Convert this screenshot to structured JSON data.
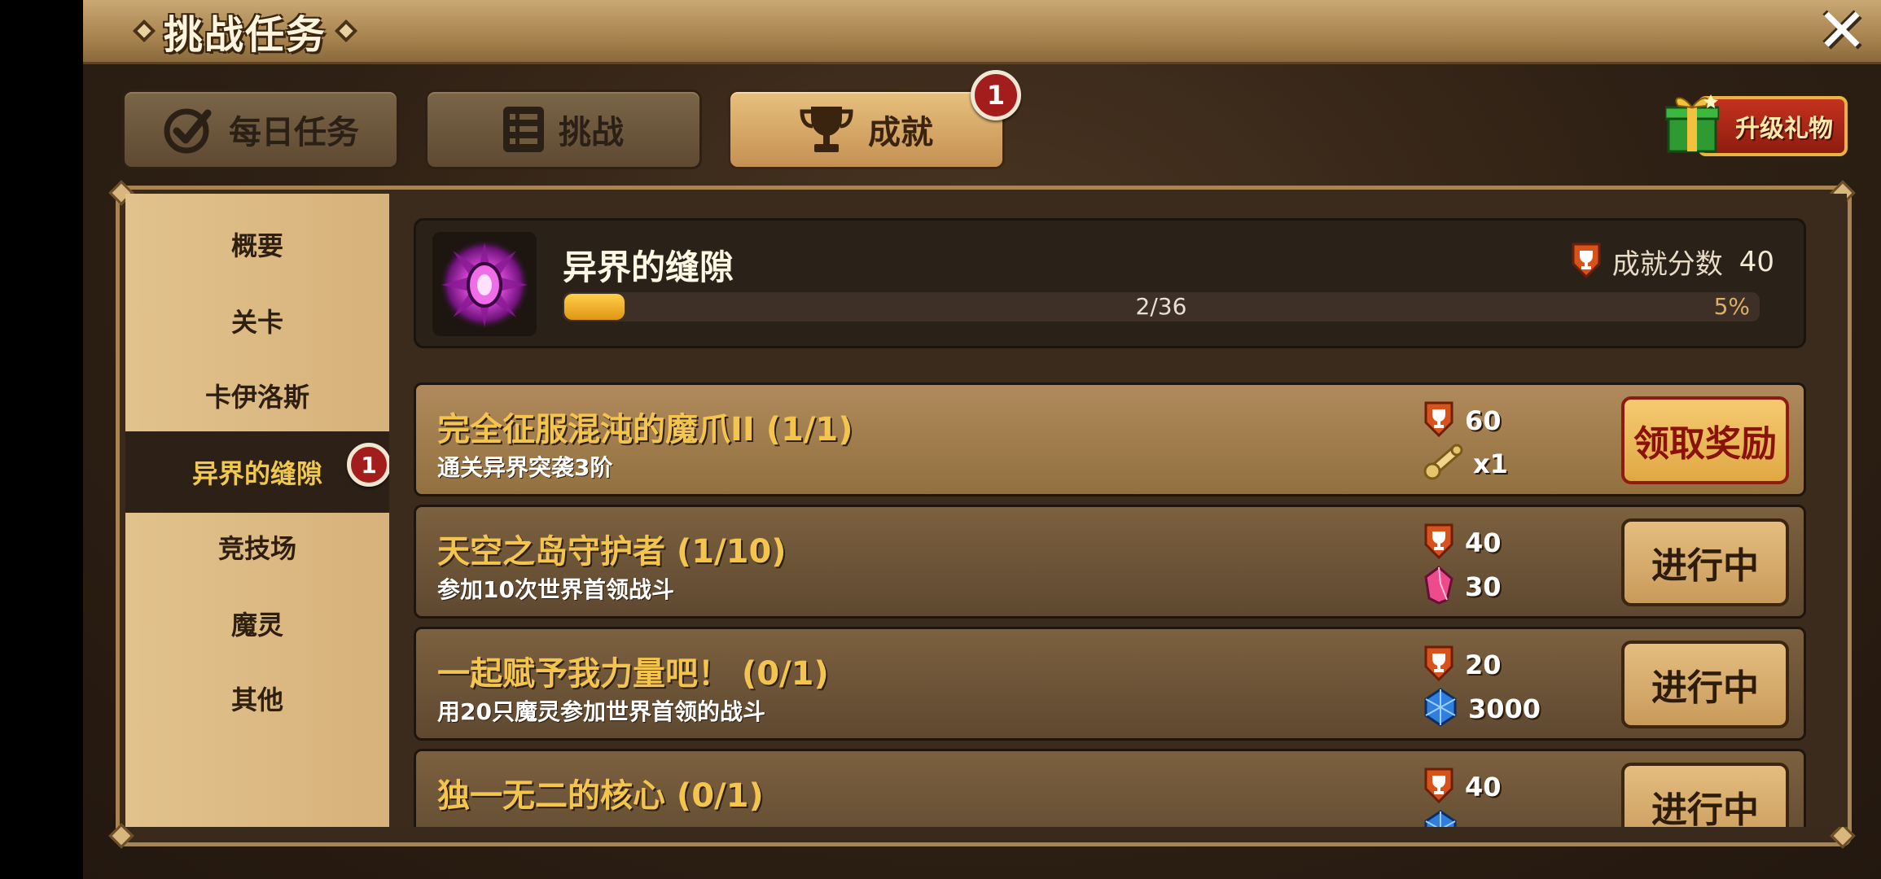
{
  "window": {
    "title": "挑战任务"
  },
  "tabs": [
    {
      "label": "每日任务",
      "icon": "check-circle-icon",
      "active": false
    },
    {
      "label": "挑战",
      "icon": "list-icon",
      "active": false
    },
    {
      "label": "成就",
      "icon": "trophy-icon",
      "active": true,
      "badge": "1"
    }
  ],
  "gift_button": {
    "label": "升级礼物"
  },
  "sidebar": {
    "items": [
      {
        "label": "概要"
      },
      {
        "label": "关卡"
      },
      {
        "label": "卡伊洛斯"
      },
      {
        "label": "异界的缝隙",
        "active": true,
        "badge": "1"
      },
      {
        "label": "竞技场"
      },
      {
        "label": "魔灵"
      },
      {
        "label": "其他"
      }
    ]
  },
  "header": {
    "title": "异界的缝隙",
    "score_label": "成就分数",
    "score_value": "40",
    "progress_text": "2/36",
    "progress_percent_text": "5%",
    "progress_fraction": 0.05
  },
  "achievements": [
    {
      "title": "完全征服混沌的魔爪II (1/1)",
      "desc": "通关异界突袭3阶",
      "points": "60",
      "reward_value": "x1",
      "reward_icon": "scroll-icon",
      "button": "领取奖励",
      "state": "claim"
    },
    {
      "title": "天空之岛守护者 (1/10)",
      "desc": "参加10次世界首领战斗",
      "points": "40",
      "reward_value": "30",
      "reward_icon": "pink-crystal-icon",
      "button": "进行中",
      "state": "in-progress"
    },
    {
      "title": "一起赋予我力量吧！ (0/1)",
      "desc": "用20只魔灵参加世界首领的战斗",
      "points": "20",
      "reward_value": "3000",
      "reward_icon": "blue-crystal-icon",
      "button": "进行中",
      "state": "in-progress"
    },
    {
      "title": "独一无二的核心 (0/1)",
      "desc": "",
      "points": "40",
      "reward_value": "",
      "reward_icon": "blue-crystal-icon",
      "button": "进行中",
      "state": "in-progress"
    }
  ],
  "colors": {
    "title_gold": "#f4c54d",
    "active_side": "#f0c84c",
    "badge_red": "#a31d1d"
  }
}
